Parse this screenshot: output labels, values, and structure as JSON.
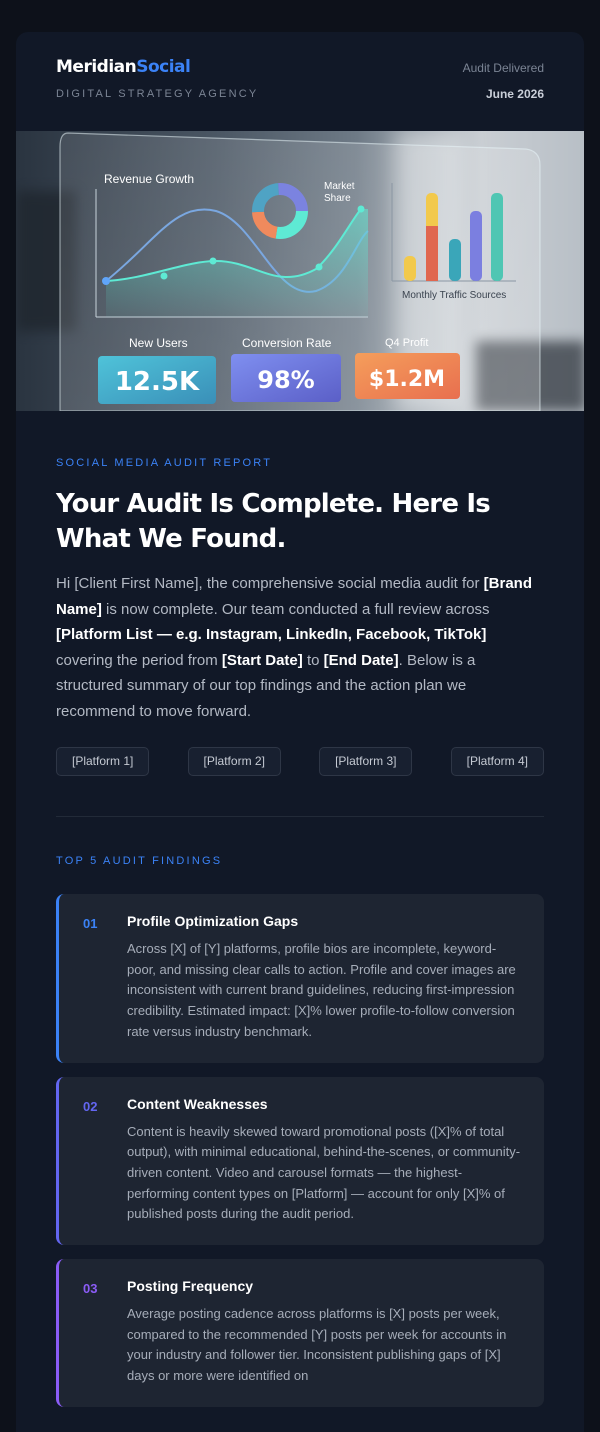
{
  "header": {
    "brand_main": "Meridian",
    "brand_accent": "Social",
    "agency": "DIGITAL STRATEGY AGENCY",
    "status_label": "Audit Delivered",
    "date": "June 2026"
  },
  "hero": {
    "revenue_label": "Revenue Growth",
    "market_label_1": "Market",
    "market_label_2": "Share",
    "traffic_label": "Monthly Traffic Sources",
    "kpis": [
      {
        "label": "New Users",
        "value": "12.5K"
      },
      {
        "label": "Conversion Rate",
        "value": "98%"
      },
      {
        "label": "Q4 Profit",
        "value": "$1.2M"
      }
    ]
  },
  "intro": {
    "eyebrow": "SOCIAL MEDIA AUDIT REPORT",
    "title": "Your Audit Is Complete. Here Is What We Found.",
    "p1": "Hi [Client First Name], the comprehensive social media audit for ",
    "brand": "[Brand Name]",
    "p2": " is now complete. Our team conducted a full review across ",
    "platforms": "[Platform List — e.g. Instagram, LinkedIn, Facebook, TikTok]",
    "p3": " covering the period from ",
    "start": "[Start Date]",
    "p4": " to ",
    "end": "[End Date]",
    "p5": ". Below is a structured summary of our top findings and the action plan we recommend to move forward."
  },
  "chips": [
    "[Platform 1]",
    "[Platform 2]",
    "[Platform 3]",
    "[Platform 4]"
  ],
  "findings": {
    "eyebrow": "TOP 5 AUDIT FINDINGS",
    "items": [
      {
        "num": "01",
        "title": "Profile Optimization Gaps",
        "body": "Across [X] of [Y] platforms, profile bios are incomplete, keyword-poor, and missing clear calls to action. Profile and cover images are inconsistent with current brand guidelines, reducing first-impression credibility. Estimated impact: [X]% lower profile-to-follow conversion rate versus industry benchmark.",
        "color": "#3b82f6"
      },
      {
        "num": "02",
        "title": "Content Weaknesses",
        "body": "Content is heavily skewed toward promotional posts ([X]% of total output), with minimal educational, behind-the-scenes, or community-driven content. Video and carousel formats — the highest-performing content types on [Platform] — account for only [X]% of published posts during the audit period.",
        "color": "#6366f1"
      },
      {
        "num": "03",
        "title": "Posting Frequency",
        "body": "Average posting cadence across platforms is [X] posts per week, compared to the recommended [Y] posts per week for accounts in your industry and follower tier. Inconsistent publishing gaps of [X] days or more were identified on",
        "color": "#8b5cf6"
      }
    ]
  }
}
